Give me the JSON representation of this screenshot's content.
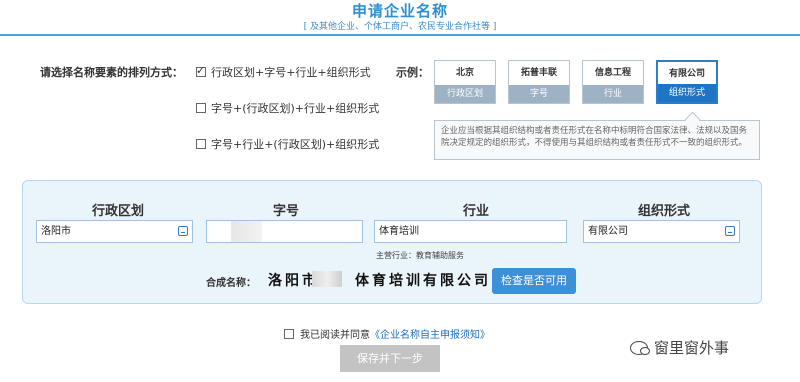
{
  "header": {
    "title": "申请企业名称",
    "subtitle": "[ 及其他企业、个体工商户、农民专业合作社等 ]"
  },
  "arrangement": {
    "prompt": "请选择名称要素的排列方式：",
    "options": [
      {
        "label": "行政区划+字号+行业+组织形式",
        "checked": true
      },
      {
        "label": "字号+(行政区划)+行业+组织形式",
        "checked": false
      },
      {
        "label": "字号+行业+(行政区划)+组织形式",
        "checked": false
      }
    ]
  },
  "examples": {
    "label": "示例：",
    "cards": [
      {
        "word": "北京",
        "caption": "行政区划",
        "active": false
      },
      {
        "word": "拓普丰联",
        "caption": "字号",
        "active": false
      },
      {
        "word": "信息工程",
        "caption": "行业",
        "active": false
      },
      {
        "word": "有限公司",
        "caption": "组织形式",
        "active": true
      }
    ],
    "note": "企业应当根据其组织结构或者责任形式在名称中标明符合国家法律、法规以及国务院决定规定的组织形式，不得使用与其组织结构或者责任形式不一致的组织形式。"
  },
  "form": {
    "columns": [
      {
        "header": "行政区划",
        "value": "洛阳市"
      },
      {
        "header": "字号",
        "value": ""
      },
      {
        "header": "行业",
        "value": "体育培训"
      },
      {
        "header": "组织形式",
        "value": "有限公司"
      }
    ],
    "industry_hint": "主营行业：教育辅助服务",
    "combined_label": "合成名称：",
    "combined_left": "洛阳市",
    "combined_right": "体育培训有限公司",
    "check_button": "检查是否可用"
  },
  "footer": {
    "agree_prefix": "我已阅读并同意",
    "agree_link": "《企业名称自主申报须知》",
    "save_button": "保存并下一步",
    "agree_checked": false
  },
  "watermark": {
    "text": "窗里窗外事",
    "icon": "wechat-icon"
  },
  "colors": {
    "accent": "#2f8fd0",
    "active_card": "#1f75c4",
    "button_blue": "#3d8fd8",
    "disabled_gray": "#c3c3c3"
  }
}
